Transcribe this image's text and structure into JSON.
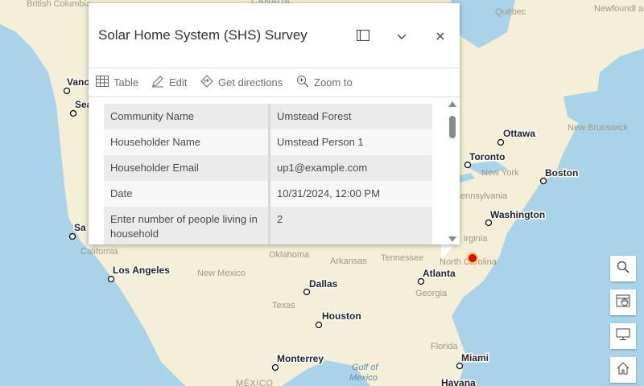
{
  "map": {
    "cities": [
      {
        "name": "Vancouver",
        "label": "Vanc"
      },
      {
        "name": "Seattle",
        "label": "Sea"
      },
      {
        "name": "San Francisco",
        "label": "Sa"
      },
      {
        "name": "Los Angeles",
        "label": "Los Angeles"
      },
      {
        "name": "Dallas",
        "label": "Dallas"
      },
      {
        "name": "Houston",
        "label": "Houston"
      },
      {
        "name": "Monterrey",
        "label": "Monterrey"
      },
      {
        "name": "Atlanta",
        "label": "Atlanta"
      },
      {
        "name": "Washington",
        "label": "Washington"
      },
      {
        "name": "Toronto",
        "label": "Toronto"
      },
      {
        "name": "Ottawa",
        "label": "Ottawa"
      },
      {
        "name": "Boston",
        "label": "Boston"
      },
      {
        "name": "Miami",
        "label": "Miami"
      },
      {
        "name": "Havana",
        "label": "Havana"
      }
    ],
    "regions": {
      "british_columbia": "British Columbia",
      "canada": "CANADA",
      "quebec": "Québec",
      "newfoundland": "Newfoundl and Labra",
      "new_brunswick": "New Brunswick",
      "new_york": "New York",
      "pennsylvania": "ennsylvania",
      "virginia": "irginia",
      "california": "California",
      "new_mexico": "New Mexico",
      "oklahoma": "Oklahoma",
      "arkansas": "Arkansas",
      "tennessee": "Tennessee",
      "north_carolina": "North Carolina",
      "georgia": "Georgia",
      "texas": "Texas",
      "florida": "Florida",
      "mexico": "MÉXICO",
      "gulf_of_mexico_1": "Gulf of",
      "gulf_of_mexico_2": "Mexico"
    },
    "marker_color": "#e60000",
    "land_color": "#f4efd6",
    "water_color": "#a9d3e8"
  },
  "popup": {
    "title": "Solar Home System (SHS) Survey",
    "actions": {
      "table": "Table",
      "edit": "Edit",
      "directions": "Get directions",
      "zoom": "Zoom to"
    },
    "fields": [
      {
        "label": "Community Name",
        "value": "Umstead Forest"
      },
      {
        "label": "Householder Name",
        "value": "Umstead Person 1"
      },
      {
        "label": "Householder Email",
        "value": "up1@example.com"
      },
      {
        "label": "Date",
        "value": "10/31/2024, 12:00 PM"
      },
      {
        "label": "Enter number of people living in household",
        "value": "2"
      }
    ]
  },
  "widgets": [
    "search-icon",
    "basemap-gallery-icon",
    "monitor-icon",
    "home-icon"
  ]
}
